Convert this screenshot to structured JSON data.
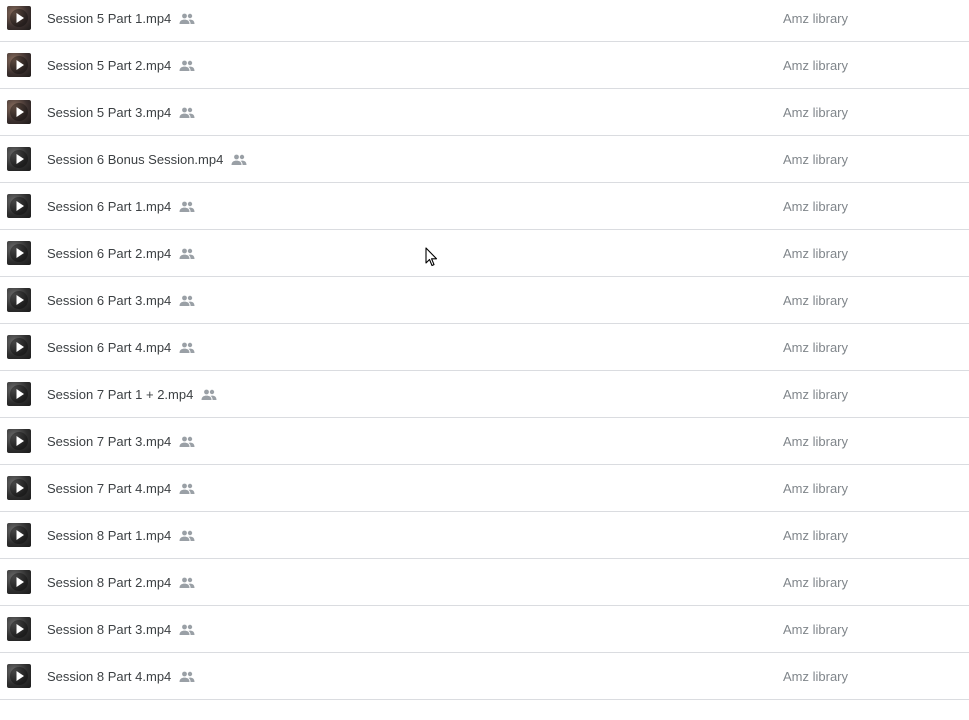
{
  "files": [
    {
      "name": "Session 5 Part 1.mp4",
      "owner": "Amz library",
      "icon": "video-play-icon",
      "shared_icon": "people-icon"
    },
    {
      "name": "Session 5 Part 2.mp4",
      "owner": "Amz library",
      "icon": "video-play-icon",
      "shared_icon": "people-icon"
    },
    {
      "name": "Session 5 Part 3.mp4",
      "owner": "Amz library",
      "icon": "video-play-icon",
      "shared_icon": "people-icon"
    },
    {
      "name": "Session 6 Bonus Session.mp4",
      "owner": "Amz library",
      "icon": "video-play-icon",
      "shared_icon": "people-icon"
    },
    {
      "name": "Session 6 Part 1.mp4",
      "owner": "Amz library",
      "icon": "video-play-icon",
      "shared_icon": "people-icon"
    },
    {
      "name": "Session 6 Part 2.mp4",
      "owner": "Amz library",
      "icon": "video-play-icon",
      "shared_icon": "people-icon"
    },
    {
      "name": "Session 6 Part 3.mp4",
      "owner": "Amz library",
      "icon": "video-play-icon",
      "shared_icon": "people-icon"
    },
    {
      "name": "Session 6 Part 4.mp4",
      "owner": "Amz library",
      "icon": "video-play-icon",
      "shared_icon": "people-icon"
    },
    {
      "name": "Session 7 Part 1 + 2.mp4",
      "owner": "Amz library",
      "icon": "video-play-icon",
      "shared_icon": "people-icon"
    },
    {
      "name": "Session 7 Part 3.mp4",
      "owner": "Amz library",
      "icon": "video-play-icon",
      "shared_icon": "people-icon"
    },
    {
      "name": "Session 7 Part 4.mp4",
      "owner": "Amz library",
      "icon": "video-play-icon",
      "shared_icon": "people-icon"
    },
    {
      "name": "Session 8 Part 1.mp4",
      "owner": "Amz library",
      "icon": "video-play-icon",
      "shared_icon": "people-icon"
    },
    {
      "name": "Session 8 Part 2.mp4",
      "owner": "Amz library",
      "icon": "video-play-icon",
      "shared_icon": "people-icon"
    },
    {
      "name": "Session 8 Part 3.mp4",
      "owner": "Amz library",
      "icon": "video-play-icon",
      "shared_icon": "people-icon"
    },
    {
      "name": "Session 8 Part 4.mp4",
      "owner": "Amz library",
      "icon": "video-play-icon",
      "shared_icon": "people-icon"
    }
  ],
  "colors": {
    "file_name_text": "#3c4043",
    "owner_text": "#80868b",
    "row_divider": "#dadce0",
    "shared_icon": "#9aa0a6",
    "background": "#ffffff"
  },
  "mouse_cursor": "arrow-cursor-icon"
}
